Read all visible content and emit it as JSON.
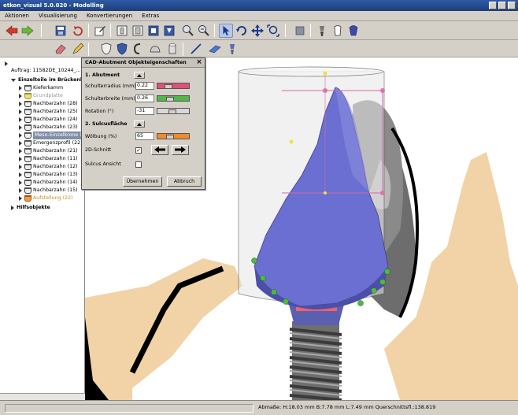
{
  "window": {
    "title": "etkon_visual 5.0.020 - Modelling"
  },
  "menu": [
    "Aktionen",
    "Visualisierung",
    "Konvertierungen",
    "Extras"
  ],
  "tree": {
    "order": "Auftrag: 11582DE_10244_...",
    "parts_group": "Einzelteile im Brückenko",
    "items": [
      {
        "label": "Kieferkamm",
        "style": "normal"
      },
      {
        "label": "Grundplatte",
        "style": "grey"
      },
      {
        "label": "Nachbarzahn (28)",
        "style": "normal"
      },
      {
        "label": "Nachbarzahn (25)",
        "style": "normal"
      },
      {
        "label": "Nachbarzahn (24)",
        "style": "normal"
      },
      {
        "label": "Nachbarzahn (23)",
        "style": "normal"
      },
      {
        "label": "Meso-Einzelkrone (2",
        "style": "selected"
      },
      {
        "label": "Emergenzprofil (22)",
        "style": "normal"
      },
      {
        "label": "Nachbarzahn (21)",
        "style": "normal"
      },
      {
        "label": "Nachbarzahn (11)",
        "style": "normal"
      },
      {
        "label": "Nachbarzahn (12)",
        "style": "normal"
      },
      {
        "label": "Nachbarzahn (13)",
        "style": "normal"
      },
      {
        "label": "Nachbarzahn (14)",
        "style": "normal"
      },
      {
        "label": "Nachbarzahn (15)",
        "style": "normal"
      },
      {
        "label": "Aufstellung (22)",
        "style": "orange"
      }
    ],
    "helper": "Hilfsobjekte"
  },
  "dialog": {
    "title": "CAD-Abutment Objekteigenschaften",
    "section1": "1. Abutment",
    "shoulder_radius_label": "Schulterradius (mm)",
    "shoulder_radius_value": "0.22",
    "shoulder_width_label": "Schulterbreite (mm)",
    "shoulder_width_value": "0.26",
    "rotation_label": "Rotation (°)",
    "rotation_value": "-31",
    "section2": "2. Sulcusfläche",
    "curvature_label": "Wölbung (%)",
    "curvature_value": "65",
    "cut2d_label": "2D-Schnitt",
    "sulcus_view_label": "Sulcus Ansicht",
    "apply_label": "Übernehmen",
    "cancel_label": "Abbruch",
    "colors": {
      "radius": "#e0507a",
      "width": "#4fb84a",
      "rotation": "#d8d8d8",
      "curvature": "#f08a2c"
    },
    "levels": {
      "radius": 0.3,
      "width": 0.35,
      "rotation": 0.45,
      "curvature": 0.35
    }
  },
  "status": {
    "text": "Abmaße: H:18.03 mm B:7.78 mm L:7.49 mm Querschnittsfl.:138.819"
  },
  "icons": [
    "undo-arrow-icon",
    "redo-arrow-icon",
    "save-icon",
    "refresh-icon",
    "edit-icon",
    "view-icon",
    "zoom-in-icon",
    "zoom-out-icon",
    "pointer-icon",
    "rotate-icon",
    "move-icon",
    "zoom-fit-icon"
  ]
}
